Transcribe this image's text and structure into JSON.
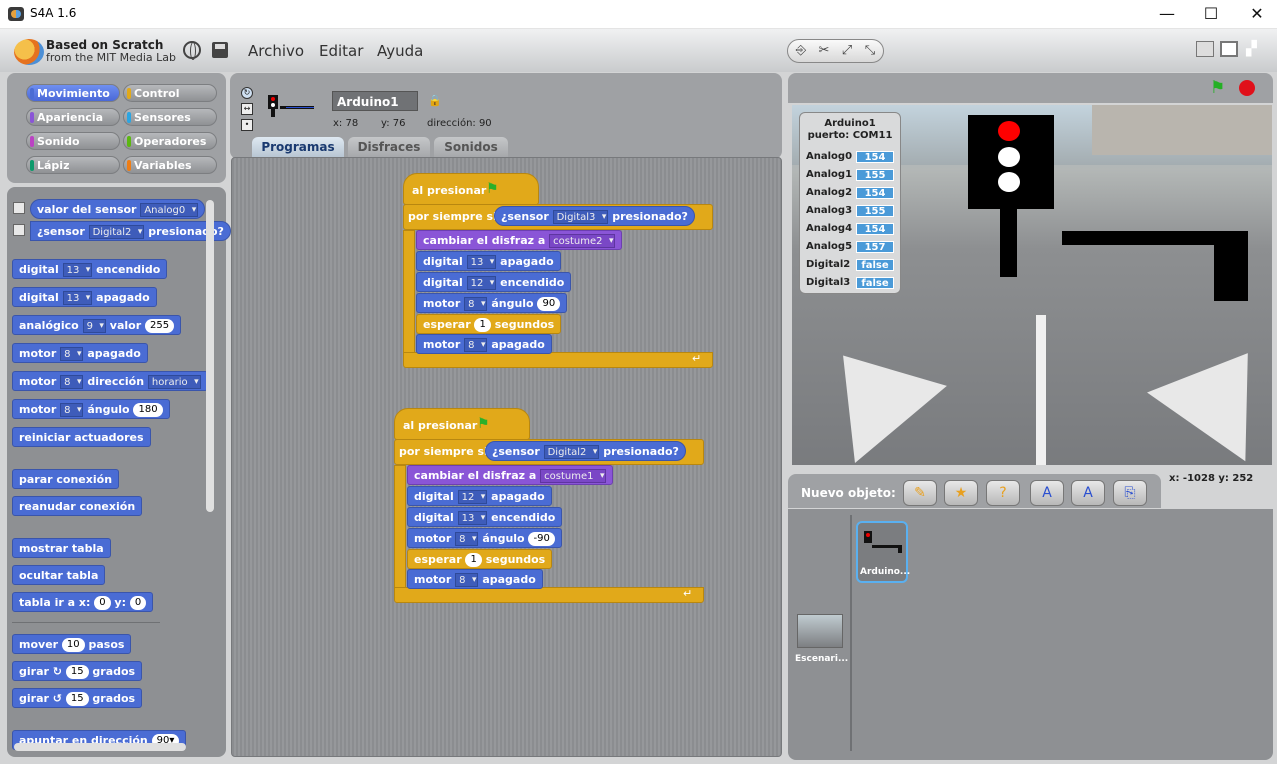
{
  "window": {
    "title": "S4A 1.6",
    "minimize": "—",
    "maximize": "☐",
    "close": "✕"
  },
  "logo": {
    "line1": "Based on Scratch",
    "line2": "from the MIT Media Lab"
  },
  "menu": [
    "Archivo",
    "Editar",
    "Ayuda"
  ],
  "categories": [
    "Movimiento",
    "Control",
    "Apariencia",
    "Sensores",
    "Sonido",
    "Operadores",
    "Lápiz",
    "Variables"
  ],
  "category_colors": {
    "Movimiento": "#4a6cd4",
    "Control": "#e1a91a",
    "Apariencia": "#8a55d7",
    "Sensores": "#2ca5e2",
    "Sonido": "#bb42c3",
    "Operadores": "#5cb712",
    "Lápiz": "#0e9a6c",
    "Variables": "#ee7d16"
  },
  "palette": {
    "sensor_value": {
      "label": "valor del sensor",
      "dd": "Analog0"
    },
    "sensor_pressed": {
      "label": "¿sensor",
      "dd": "Digital2",
      "suffix": "presionado?"
    },
    "digital_on": {
      "label": "digital",
      "dd": "13",
      "suffix": "encendido"
    },
    "digital_off": {
      "label": "digital",
      "dd": "13",
      "suffix": "apagado"
    },
    "analog": {
      "label": "analógico",
      "dd": "9",
      "mid": "valor",
      "num": "255"
    },
    "motor_off": {
      "label": "motor",
      "dd": "8",
      "suffix": "apagado"
    },
    "motor_dir": {
      "label": "motor",
      "dd": "8",
      "mid": "dirección",
      "dd2": "horario"
    },
    "motor_angle": {
      "label": "motor",
      "dd": "8",
      "mid": "ángulo",
      "num": "180"
    },
    "reset": "reiniciar actuadores",
    "stop_conn": "parar conexión",
    "resume_conn": "reanudar conexión",
    "show_table": "mostrar tabla",
    "hide_table": "ocultar tabla",
    "table_go": {
      "label": "tabla ir a x:",
      "x": "0",
      "ylabel": "y:",
      "y": "0"
    },
    "move": {
      "label": "mover",
      "num": "10",
      "suffix": "pasos"
    },
    "turn_cw": {
      "label": "girar",
      "num": "15",
      "suffix": "grados"
    },
    "turn_ccw": {
      "label": "girar",
      "num": "15",
      "suffix": "grados"
    },
    "point_dir": {
      "label": "apuntar en dirección",
      "num": "90▾"
    }
  },
  "sprite": {
    "name": "Arduino1",
    "x": "x: 78",
    "y": "y: 76",
    "dir": "dirección: 90"
  },
  "tabs": [
    "Programas",
    "Disfraces",
    "Sonidos"
  ],
  "script1": {
    "hat": "al presionar",
    "forever": "por siempre si",
    "sensor": "¿sensor",
    "sensor_dd": "Digital3",
    "pressed": "presionado?",
    "costume_label": "cambiar el disfraz a",
    "costume": "costume2",
    "d1": {
      "label": "digital",
      "dd": "13",
      "suffix": "apagado"
    },
    "d2": {
      "label": "digital",
      "dd": "12",
      "suffix": "encendido"
    },
    "m1": {
      "label": "motor",
      "dd": "8",
      "mid": "ángulo",
      "num": "90"
    },
    "wait": {
      "label": "esperar",
      "num": "1",
      "suffix": "segundos"
    },
    "m2": {
      "label": "motor",
      "dd": "8",
      "suffix": "apagado"
    }
  },
  "script2": {
    "hat": "al presionar",
    "forever": "por siempre si",
    "sensor": "¿sensor",
    "sensor_dd": "Digital2",
    "pressed": "presionado?",
    "costume_label": "cambiar el disfraz a",
    "costume": "costume1",
    "d1": {
      "label": "digital",
      "dd": "12",
      "suffix": "apagado"
    },
    "d2": {
      "label": "digital",
      "dd": "13",
      "suffix": "encendido"
    },
    "m1": {
      "label": "motor",
      "dd": "8",
      "mid": "ángulo",
      "num": "-90"
    },
    "wait": {
      "label": "esperar",
      "num": "1",
      "suffix": "segundos"
    },
    "m2": {
      "label": "motor",
      "dd": "8",
      "suffix": "apagado"
    }
  },
  "watcher": {
    "title1": "Arduino1",
    "title2": "puerto: COM11",
    "rows": [
      {
        "label": "Analog0",
        "value": "154"
      },
      {
        "label": "Analog1",
        "value": "155"
      },
      {
        "label": "Analog2",
        "value": "154"
      },
      {
        "label": "Analog3",
        "value": "155"
      },
      {
        "label": "Analog4",
        "value": "154"
      },
      {
        "label": "Analog5",
        "value": "157"
      },
      {
        "label": "Digital2",
        "value": "false"
      },
      {
        "label": "Digital3",
        "value": "false"
      }
    ]
  },
  "mouse": "x: -1028  y: 252",
  "new_object": "Nuevo objeto:",
  "sprites": [
    {
      "name": "Arduino..."
    }
  ],
  "stage_thumb": "Escenari..."
}
